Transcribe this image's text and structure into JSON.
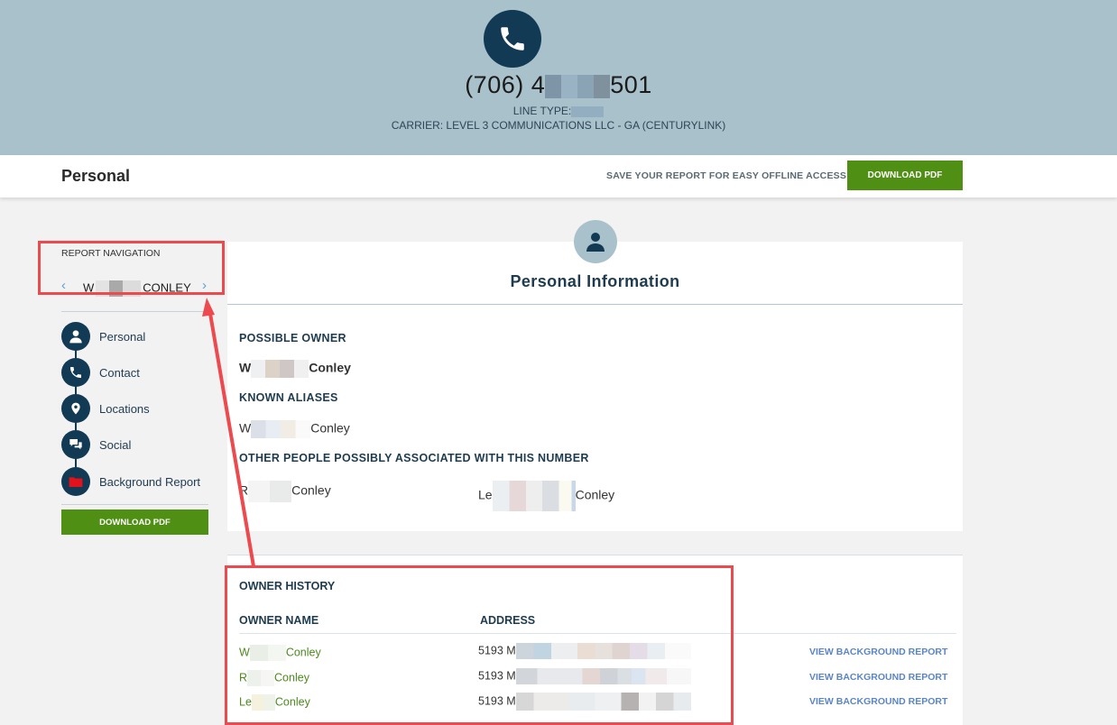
{
  "header": {
    "phone_prefix": "(706) 4",
    "phone_suffix": "501",
    "line_type_label": "LINE TYPE:",
    "carrier": "CARRIER: LEVEL 3 COMMUNICATIONS LLC - GA (CENTURYLINK)"
  },
  "toolbar": {
    "title": "Personal",
    "save_text": "SAVE YOUR REPORT FOR EASY OFFLINE ACCESS:",
    "download_label": "DOWNLOAD PDF"
  },
  "sidebar": {
    "nav_label": "REPORT NAVIGATION",
    "name_prefix": "W",
    "name_suffix": "CONLEY",
    "items": [
      {
        "label": "Personal",
        "icon": "person-icon"
      },
      {
        "label": "Contact",
        "icon": "phone-icon"
      },
      {
        "label": "Locations",
        "icon": "location-pin-icon"
      },
      {
        "label": "Social",
        "icon": "chat-icon"
      },
      {
        "label": "Background Report",
        "icon": "folder-icon"
      }
    ],
    "download_label": "DOWNLOAD PDF"
  },
  "personal_info": {
    "title": "Personal Information",
    "possible_owner_label": "POSSIBLE OWNER",
    "possible_owner_prefix": "W",
    "possible_owner_suffix": "Conley",
    "aliases_label": "KNOWN ALIASES",
    "alias_prefix": "W",
    "alias_suffix": "Conley",
    "associated_label": "OTHER PEOPLE POSSIBLY ASSOCIATED WITH THIS NUMBER",
    "associated": [
      {
        "prefix": "R",
        "suffix": "Conley"
      },
      {
        "prefix": "Le",
        "suffix": "Conley"
      }
    ]
  },
  "owner_history": {
    "title": "OWNER HISTORY",
    "col_name": "OWNER NAME",
    "col_address": "ADDRESS",
    "rows": [
      {
        "name_prefix": "W",
        "name_suffix": "Conley",
        "address_prefix": "5193 M",
        "link": "VIEW BACKGROUND REPORT"
      },
      {
        "name_prefix": "R",
        "name_suffix": "Conley",
        "address_prefix": "5193 M",
        "link": "VIEW BACKGROUND REPORT"
      },
      {
        "name_prefix": "Le",
        "name_suffix": "Conley",
        "address_prefix": "5193 M",
        "link": "VIEW BACKGROUND REPORT"
      }
    ]
  },
  "colors": {
    "hero_bg": "#a9c1cb",
    "navy": "#123a55",
    "green_button": "#4f8f13",
    "link_blue": "#5b86c5",
    "annotation_red": "#ec4a4e"
  }
}
